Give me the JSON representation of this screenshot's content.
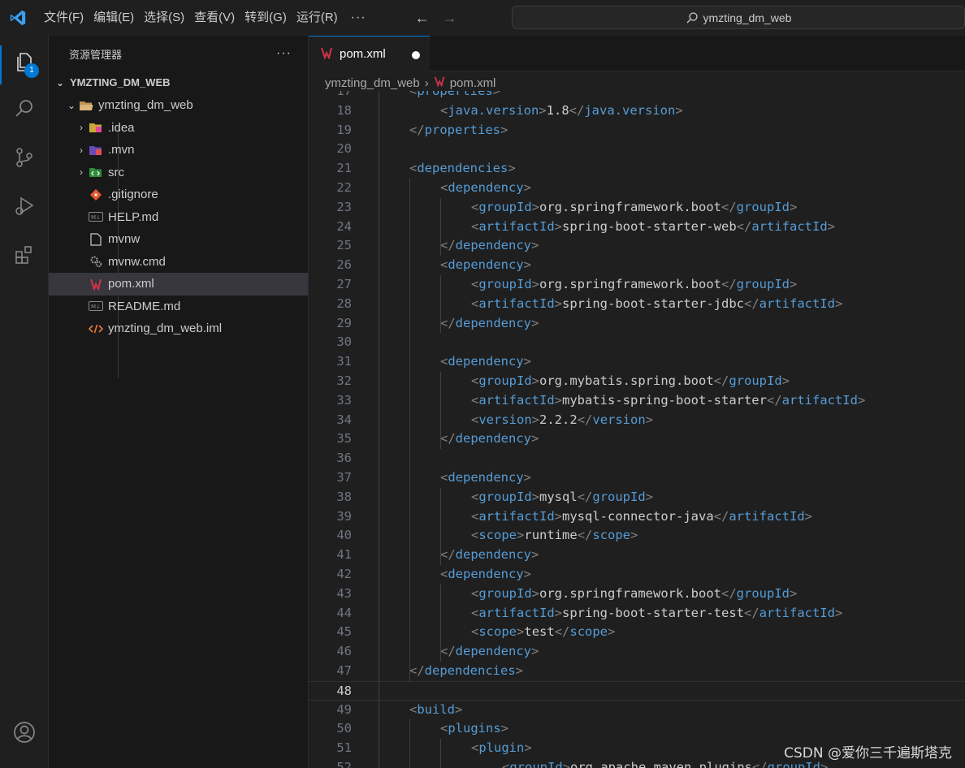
{
  "menu": [
    "文件(F)",
    "编辑(E)",
    "选择(S)",
    "查看(V)",
    "转到(G)",
    "运行(R)"
  ],
  "menu_more": "···",
  "search": {
    "label": "ymzting_dm_web",
    "icon": "search-icon"
  },
  "activity": {
    "explorer_badge": "1"
  },
  "sidebar": {
    "title": "资源管理器",
    "more": "···",
    "root": "YMZTING_DM_WEB",
    "items": [
      {
        "label": "ymzting_dm_web",
        "icon": "folder-open-icon"
      },
      {
        "label": ".idea",
        "icon": "idea-folder-icon"
      },
      {
        "label": ".mvn",
        "icon": "maven-folder-icon"
      },
      {
        "label": "src",
        "icon": "src-folder-icon"
      },
      {
        "label": ".gitignore",
        "icon": "git-icon"
      },
      {
        "label": "HELP.md",
        "icon": "markdown-icon"
      },
      {
        "label": "mvnw",
        "icon": "file-icon"
      },
      {
        "label": "mvnw.cmd",
        "icon": "gear-icon"
      },
      {
        "label": "pom.xml",
        "icon": "maven-icon"
      },
      {
        "label": "README.md",
        "icon": "markdown-icon"
      },
      {
        "label": "ymzting_dm_web.iml",
        "icon": "xml-icon"
      }
    ]
  },
  "editor": {
    "tab_label": "pom.xml",
    "breadcrumb": [
      "ymzting_dm_web",
      "pom.xml"
    ],
    "current_line": "48",
    "lines": [
      {
        "num": "17",
        "text": "<properties>",
        "indent": 1
      },
      {
        "num": "18",
        "text": "<java.version>1.8</java.version>",
        "indent": 2
      },
      {
        "num": "19",
        "text": "</properties>",
        "indent": 1
      },
      {
        "num": "20",
        "text": "",
        "indent": 0
      },
      {
        "num": "21",
        "text": "<dependencies>",
        "indent": 1
      },
      {
        "num": "22",
        "text": "<dependency>",
        "indent": 2
      },
      {
        "num": "23",
        "text": "<groupId>org.springframework.boot</groupId>",
        "indent": 3
      },
      {
        "num": "24",
        "text": "<artifactId>spring-boot-starter-web</artifactId>",
        "indent": 3
      },
      {
        "num": "25",
        "text": "</dependency>",
        "indent": 2
      },
      {
        "num": "26",
        "text": "<dependency>",
        "indent": 2
      },
      {
        "num": "27",
        "text": "<groupId>org.springframework.boot</groupId>",
        "indent": 3
      },
      {
        "num": "28",
        "text": "<artifactId>spring-boot-starter-jdbc</artifactId>",
        "indent": 3
      },
      {
        "num": "29",
        "text": "</dependency>",
        "indent": 2
      },
      {
        "num": "30",
        "text": "",
        "indent": 0
      },
      {
        "num": "31",
        "text": "<dependency>",
        "indent": 2
      },
      {
        "num": "32",
        "text": "<groupId>org.mybatis.spring.boot</groupId>",
        "indent": 3
      },
      {
        "num": "33",
        "text": "<artifactId>mybatis-spring-boot-starter</artifactId>",
        "indent": 3
      },
      {
        "num": "34",
        "text": "<version>2.2.2</version>",
        "indent": 3
      },
      {
        "num": "35",
        "text": "</dependency>",
        "indent": 2
      },
      {
        "num": "36",
        "text": "",
        "indent": 0
      },
      {
        "num": "37",
        "text": "<dependency>",
        "indent": 2
      },
      {
        "num": "38",
        "text": "<groupId>mysql</groupId>",
        "indent": 3
      },
      {
        "num": "39",
        "text": "<artifactId>mysql-connector-java</artifactId>",
        "indent": 3
      },
      {
        "num": "40",
        "text": "<scope>runtime</scope>",
        "indent": 3
      },
      {
        "num": "41",
        "text": "</dependency>",
        "indent": 2
      },
      {
        "num": "42",
        "text": "<dependency>",
        "indent": 2
      },
      {
        "num": "43",
        "text": "<groupId>org.springframework.boot</groupId>",
        "indent": 3
      },
      {
        "num": "44",
        "text": "<artifactId>spring-boot-starter-test</artifactId>",
        "indent": 3
      },
      {
        "num": "45",
        "text": "<scope>test</scope>",
        "indent": 3
      },
      {
        "num": "46",
        "text": "</dependency>",
        "indent": 2
      },
      {
        "num": "47",
        "text": "</dependencies>",
        "indent": 1
      },
      {
        "num": "48",
        "text": "",
        "indent": 0
      },
      {
        "num": "49",
        "text": "<build>",
        "indent": 1
      },
      {
        "num": "50",
        "text": "<plugins>",
        "indent": 2
      },
      {
        "num": "51",
        "text": "<plugin>",
        "indent": 3
      },
      {
        "num": "52",
        "text": "<groupId>org.apache.maven.plugins</groupId>",
        "indent": 4
      }
    ]
  },
  "watermark": "CSDN @爱你三千遍斯塔克",
  "colors": {
    "accent": "#0078d4",
    "tag": "#569cd6",
    "bracket": "#808080",
    "text": "#cccccc"
  }
}
